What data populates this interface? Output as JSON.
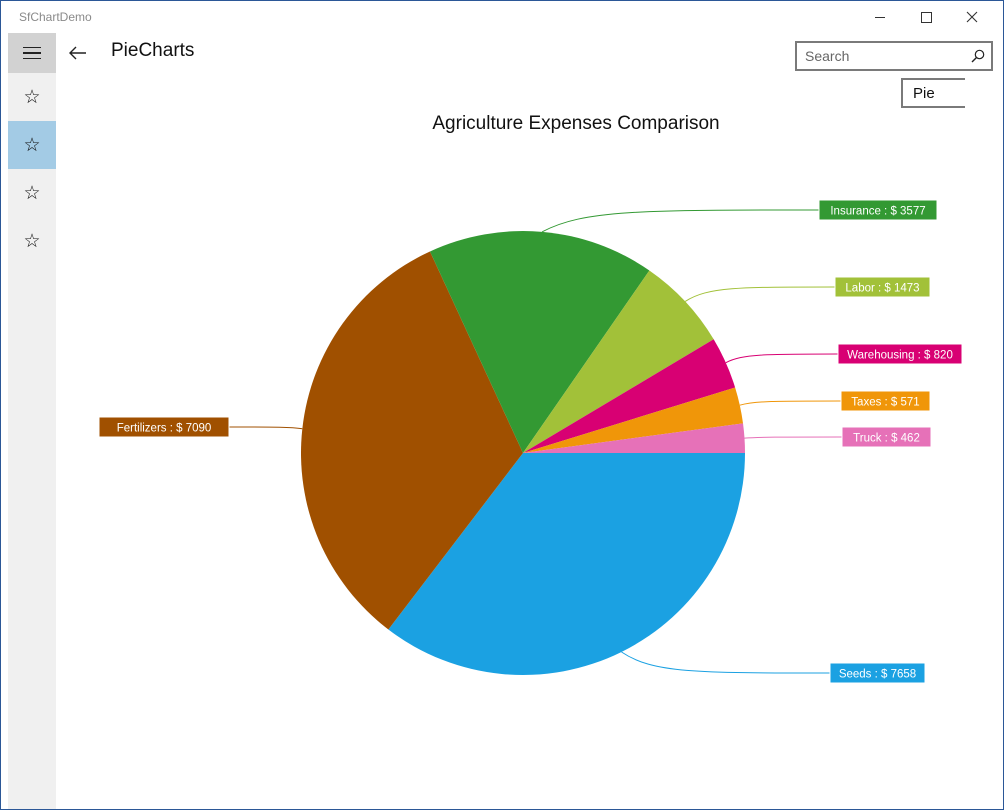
{
  "window": {
    "app_title": "SfChartDemo"
  },
  "header": {
    "page_title": "PieCharts",
    "search_placeholder": "Search",
    "combo_value": "Pie"
  },
  "sidebar": {
    "items": [
      "☆",
      "☆",
      "☆",
      "☆"
    ],
    "selected_index": 1
  },
  "chart_data": {
    "type": "pie",
    "title": "Agriculture Expenses Comparison",
    "currency": "$",
    "slices": [
      {
        "label": "Seeds",
        "value": 7658,
        "color": "#1ba1e2"
      },
      {
        "label": "Fertilizers",
        "value": 7090,
        "color": "#a05000"
      },
      {
        "label": "Insurance",
        "value": 3577,
        "color": "#339933"
      },
      {
        "label": "Labor",
        "value": 1473,
        "color": "#a2c139"
      },
      {
        "label": "Warehousing",
        "value": 820,
        "color": "#d80073"
      },
      {
        "label": "Taxes",
        "value": 571,
        "color": "#f09609"
      },
      {
        "label": "Truck",
        "value": 462,
        "color": "#e671b8"
      }
    ]
  }
}
